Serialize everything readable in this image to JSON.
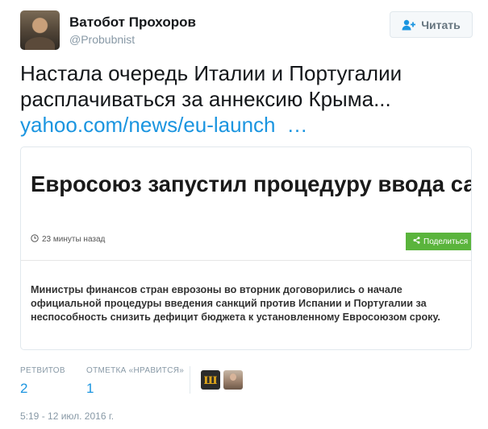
{
  "author": {
    "display_name": "Ватобот Прохоров",
    "handle": "@Probubnist"
  },
  "follow_button": {
    "label": "Читать",
    "icon": "follow-user-icon"
  },
  "tweet": {
    "text": "Настала очередь Италии и Португалии расплачиваться за аннексию Крыма...",
    "link_text": "yahoo.com/news/eu-launch",
    "link_ellipsis": "…"
  },
  "card": {
    "title": "Евросоюз запустил процедуру ввода санкций против Испании и Португалии",
    "time": "23 минуты назад",
    "share_label": "Поделиться",
    "description": "Министры финансов стран еврозоны во вторник договорились о начале официальной процедуры введения санкций против Испании и Португалии за неспособность снизить дефицит бюджета к установленному Евросоюзом сроку."
  },
  "stats": {
    "retweets_label": "РЕТВИТОВ",
    "retweets_count": "2",
    "likes_label": "ОТМЕТКА «НРАВИТСЯ»",
    "likes_count": "1"
  },
  "likers": [
    {
      "icon": "liker-avatar-logo",
      "glyph": "ш"
    },
    {
      "icon": "liker-avatar-photo"
    }
  ],
  "timestamp": "5:19 - 12 июл. 2016 г.",
  "colors": {
    "link": "#1b95e0",
    "muted": "#8899a6",
    "share_green": "#5ab43c"
  }
}
